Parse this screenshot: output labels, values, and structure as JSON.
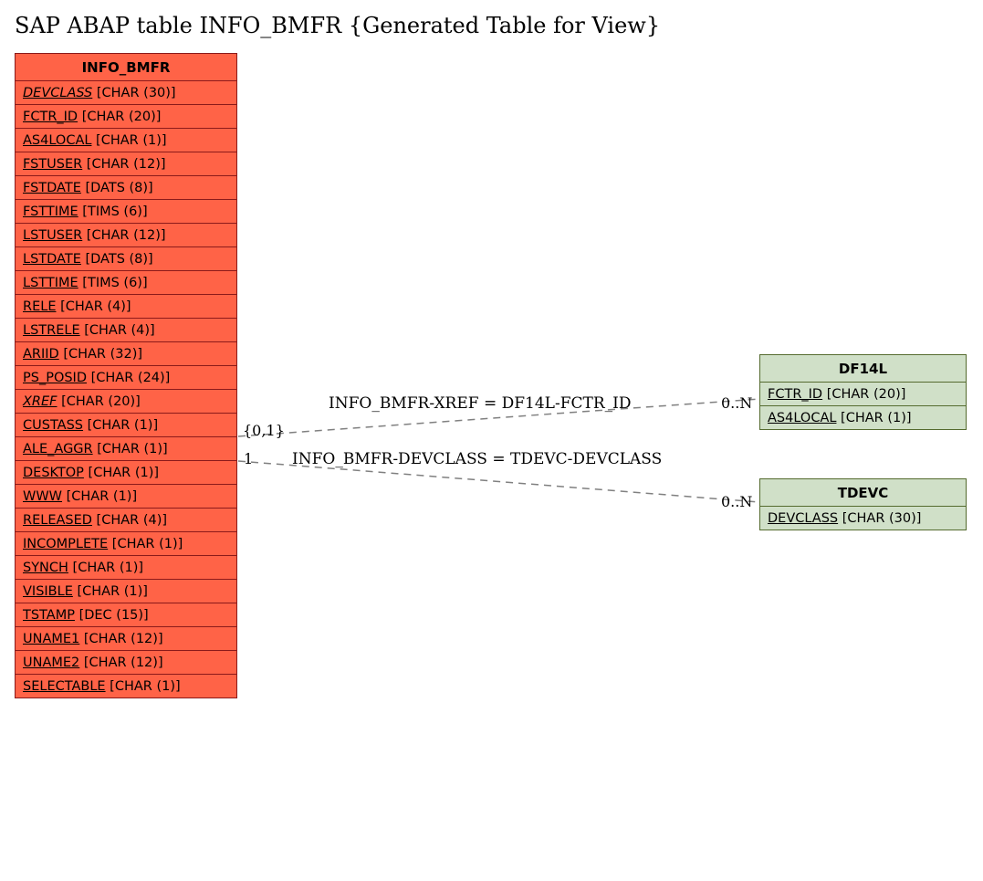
{
  "title": "SAP ABAP table INFO_BMFR {Generated Table for View}",
  "mainTable": {
    "name": "INFO_BMFR",
    "fields": [
      {
        "name": "DEVCLASS",
        "type": "[CHAR (30)]",
        "italic": true
      },
      {
        "name": "FCTR_ID",
        "type": "[CHAR (20)]",
        "italic": false
      },
      {
        "name": "AS4LOCAL",
        "type": "[CHAR (1)]",
        "italic": false
      },
      {
        "name": "FSTUSER",
        "type": "[CHAR (12)]",
        "italic": false
      },
      {
        "name": "FSTDATE",
        "type": "[DATS (8)]",
        "italic": false
      },
      {
        "name": "FSTTIME",
        "type": "[TIMS (6)]",
        "italic": false
      },
      {
        "name": "LSTUSER",
        "type": "[CHAR (12)]",
        "italic": false
      },
      {
        "name": "LSTDATE",
        "type": "[DATS (8)]",
        "italic": false
      },
      {
        "name": "LSTTIME",
        "type": "[TIMS (6)]",
        "italic": false
      },
      {
        "name": "RELE",
        "type": "[CHAR (4)]",
        "italic": false
      },
      {
        "name": "LSTRELE",
        "type": "[CHAR (4)]",
        "italic": false
      },
      {
        "name": "ARIID",
        "type": "[CHAR (32)]",
        "italic": false
      },
      {
        "name": "PS_POSID",
        "type": "[CHAR (24)]",
        "italic": false
      },
      {
        "name": "XREF",
        "type": "[CHAR (20)]",
        "italic": true
      },
      {
        "name": "CUSTASS",
        "type": "[CHAR (1)]",
        "italic": false
      },
      {
        "name": "ALE_AGGR",
        "type": "[CHAR (1)]",
        "italic": false
      },
      {
        "name": "DESKTOP",
        "type": "[CHAR (1)]",
        "italic": false
      },
      {
        "name": "WWW",
        "type": "[CHAR (1)]",
        "italic": false
      },
      {
        "name": "RELEASED",
        "type": "[CHAR (4)]",
        "italic": false
      },
      {
        "name": "INCOMPLETE",
        "type": "[CHAR (1)]",
        "italic": false
      },
      {
        "name": "SYNCH",
        "type": "[CHAR (1)]",
        "italic": false
      },
      {
        "name": "VISIBLE",
        "type": "[CHAR (1)]",
        "italic": false
      },
      {
        "name": "TSTAMP",
        "type": "[DEC (15)]",
        "italic": false
      },
      {
        "name": "UNAME1",
        "type": "[CHAR (12)]",
        "italic": false
      },
      {
        "name": "UNAME2",
        "type": "[CHAR (12)]",
        "italic": false
      },
      {
        "name": "SELECTABLE",
        "type": "[CHAR (1)]",
        "italic": false
      }
    ]
  },
  "relTable1": {
    "name": "DF14L",
    "fields": [
      {
        "name": "FCTR_ID",
        "type": "[CHAR (20)]"
      },
      {
        "name": "AS4LOCAL",
        "type": "[CHAR (1)]"
      }
    ]
  },
  "relTable2": {
    "name": "TDEVC",
    "fields": [
      {
        "name": "DEVCLASS",
        "type": "[CHAR (30)]"
      }
    ]
  },
  "relations": {
    "r1": {
      "label": "INFO_BMFR-XREF = DF14L-FCTR_ID",
      "leftCard": "{0,1}",
      "rightCard": "0..N"
    },
    "r2": {
      "label": "INFO_BMFR-DEVCLASS = TDEVC-DEVCLASS",
      "leftCard": "1",
      "rightCard": "0..N"
    }
  }
}
